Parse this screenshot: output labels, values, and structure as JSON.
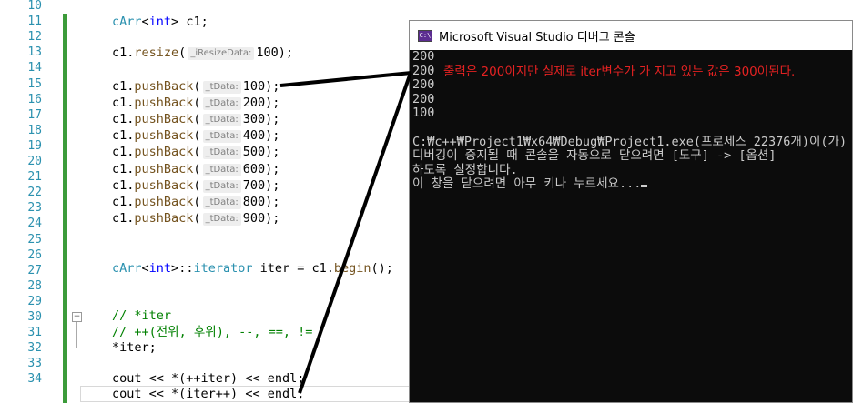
{
  "editor": {
    "line_numbers": [
      "10",
      "11",
      "12",
      "13",
      "14",
      "15",
      "16",
      "17",
      "18",
      "19",
      "20",
      "21",
      "22",
      "23",
      "24",
      "25",
      "26",
      "27",
      "28",
      "29",
      "30",
      "31",
      "32",
      "33",
      "34"
    ],
    "lines": {
      "l11": {
        "type": "cArr",
        "lt": "<",
        "tparam": "int",
        "gt": ">",
        "rest": " c1;"
      },
      "l13": {
        "obj": "c1.",
        "fn": "resize",
        "open": "(",
        "hint": "_iResizeData:",
        "val": "100",
        "close": ");"
      },
      "pushbacks": [
        {
          "obj": "c1.",
          "fn": "pushBack",
          "open": "(",
          "hint": "_tData:",
          "val": "100",
          "close": ");"
        },
        {
          "obj": "c1.",
          "fn": "pushBack",
          "open": "(",
          "hint": "_tData:",
          "val": "200",
          "close": ");"
        },
        {
          "obj": "c1.",
          "fn": "pushBack",
          "open": "(",
          "hint": "_tData:",
          "val": "300",
          "close": ");"
        },
        {
          "obj": "c1.",
          "fn": "pushBack",
          "open": "(",
          "hint": "_tData:",
          "val": "400",
          "close": ");"
        },
        {
          "obj": "c1.",
          "fn": "pushBack",
          "open": "(",
          "hint": "_tData:",
          "val": "500",
          "close": ");"
        },
        {
          "obj": "c1.",
          "fn": "pushBack",
          "open": "(",
          "hint": "_tData:",
          "val": "600",
          "close": ");"
        },
        {
          "obj": "c1.",
          "fn": "pushBack",
          "open": "(",
          "hint": "_tData:",
          "val": "700",
          "close": ");"
        },
        {
          "obj": "c1.",
          "fn": "pushBack",
          "open": "(",
          "hint": "_tData:",
          "val": "800",
          "close": ");"
        },
        {
          "obj": "c1.",
          "fn": "pushBack",
          "open": "(",
          "hint": "_tData:",
          "val": "900",
          "close": ");"
        }
      ],
      "l26": {
        "type": "cArr",
        "lt": "<",
        "tparam": "int",
        "gt": ">",
        "scope": "::",
        "itype": "iterator",
        "mid": " iter = c1.",
        "fn": "begin",
        "end": "();"
      },
      "l29": "// *iter",
      "l30": "// ++(전위, 후위), --, ==, !=",
      "l31": "*iter;",
      "l33": {
        "a": "cout ",
        "op": "<<",
        "b": " *(++iter) ",
        "op2": "<<",
        "c": " endl;"
      },
      "l34": {
        "a": "cout ",
        "op": "<<",
        "b": " *(iter++) ",
        "op2": "<<",
        "c": " endl;"
      }
    }
  },
  "console": {
    "title": "Microsoft Visual Studio 디버그 콘솔",
    "icon_name": "console-app-icon",
    "output_lines": [
      "200",
      "200",
      "200",
      "200",
      "100",
      "",
      "C:₩c++₩Project1₩x64₩Debug₩Project1.exe(프로세스 22376개)이(가)",
      "디버깅이 중지될 때 콘솔을 자동으로 닫으려면 [도구] -> [옵션]",
      "하도록 설정합니다.",
      "이 창을 닫으려면 아무 키나 누르세요..."
    ],
    "annotation": "출력은 200이지만 실제로 iter변수가 가 지고 있는 값은 300이된다."
  },
  "colors": {
    "line_number": "#2b91af",
    "keyword": "#0000ff",
    "class": "#2b91af",
    "function": "#74531f",
    "comment": "#008000",
    "annotation": "#e52222",
    "console_bg": "#0c0c0c",
    "console_text": "#cccccc",
    "change_bar": "#3c9b3a"
  }
}
